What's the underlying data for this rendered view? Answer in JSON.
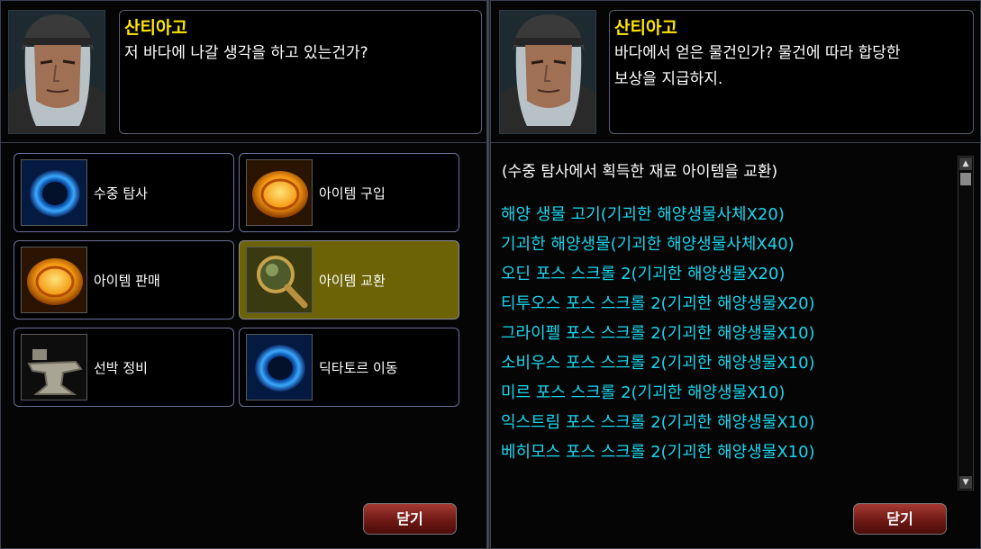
{
  "left_panel": {
    "npc_name": "산티아고",
    "dialog_text": "저 바다에 나갈 생각을 하고 있는건가?",
    "menu": [
      {
        "label": "수중 탐사",
        "icon": "blue-portal-ring-icon",
        "selected": false
      },
      {
        "label": "아이템 구입",
        "icon": "gold-coin-icon",
        "selected": false
      },
      {
        "label": "아이템 판매",
        "icon": "gold-coin-icon",
        "selected": false
      },
      {
        "label": "아이템 교환",
        "icon": "magnifier-icon",
        "selected": true
      },
      {
        "label": "선박 정비",
        "icon": "anvil-icon",
        "selected": false
      },
      {
        "label": "딕타토르 이동",
        "icon": "blue-portal-ring-icon",
        "selected": false
      }
    ],
    "close_label": "닫기"
  },
  "right_panel": {
    "npc_name": "산티아고",
    "dialog_line1": "바다에서 얻은 물건인가? 물건에 따라 합당한",
    "dialog_line2": "보상을 지급하지.",
    "list_header": "(수중 탐사에서 획득한 재료 아이템을 교환)",
    "items": [
      "해양 생물 고기(기괴한 해양생물사체X20)",
      "기괴한 해양생물(기괴한 해양생물사체X40)",
      "오딘 포스 스크롤 2(기괴한 해양생물X20)",
      "티투오스 포스 스크롤 2(기괴한 해양생물X20)",
      "그라이펠 포스 스크롤 2(기괴한 해양생물X10)",
      "소비우스 포스 스크롤 2(기괴한 해양생물X10)",
      "미르 포스 스크롤 2(기괴한 해양생물X10)",
      "익스트림 포스 스크롤 2(기괴한 해양생물X10)",
      "베히모스 포스 스크롤 2(기괴한 해양생물X10)"
    ],
    "close_label": "닫기"
  },
  "colors": {
    "npc_name": "#ffe600",
    "list_item": "#19d6ee",
    "selected_bg": "#6b6306"
  }
}
